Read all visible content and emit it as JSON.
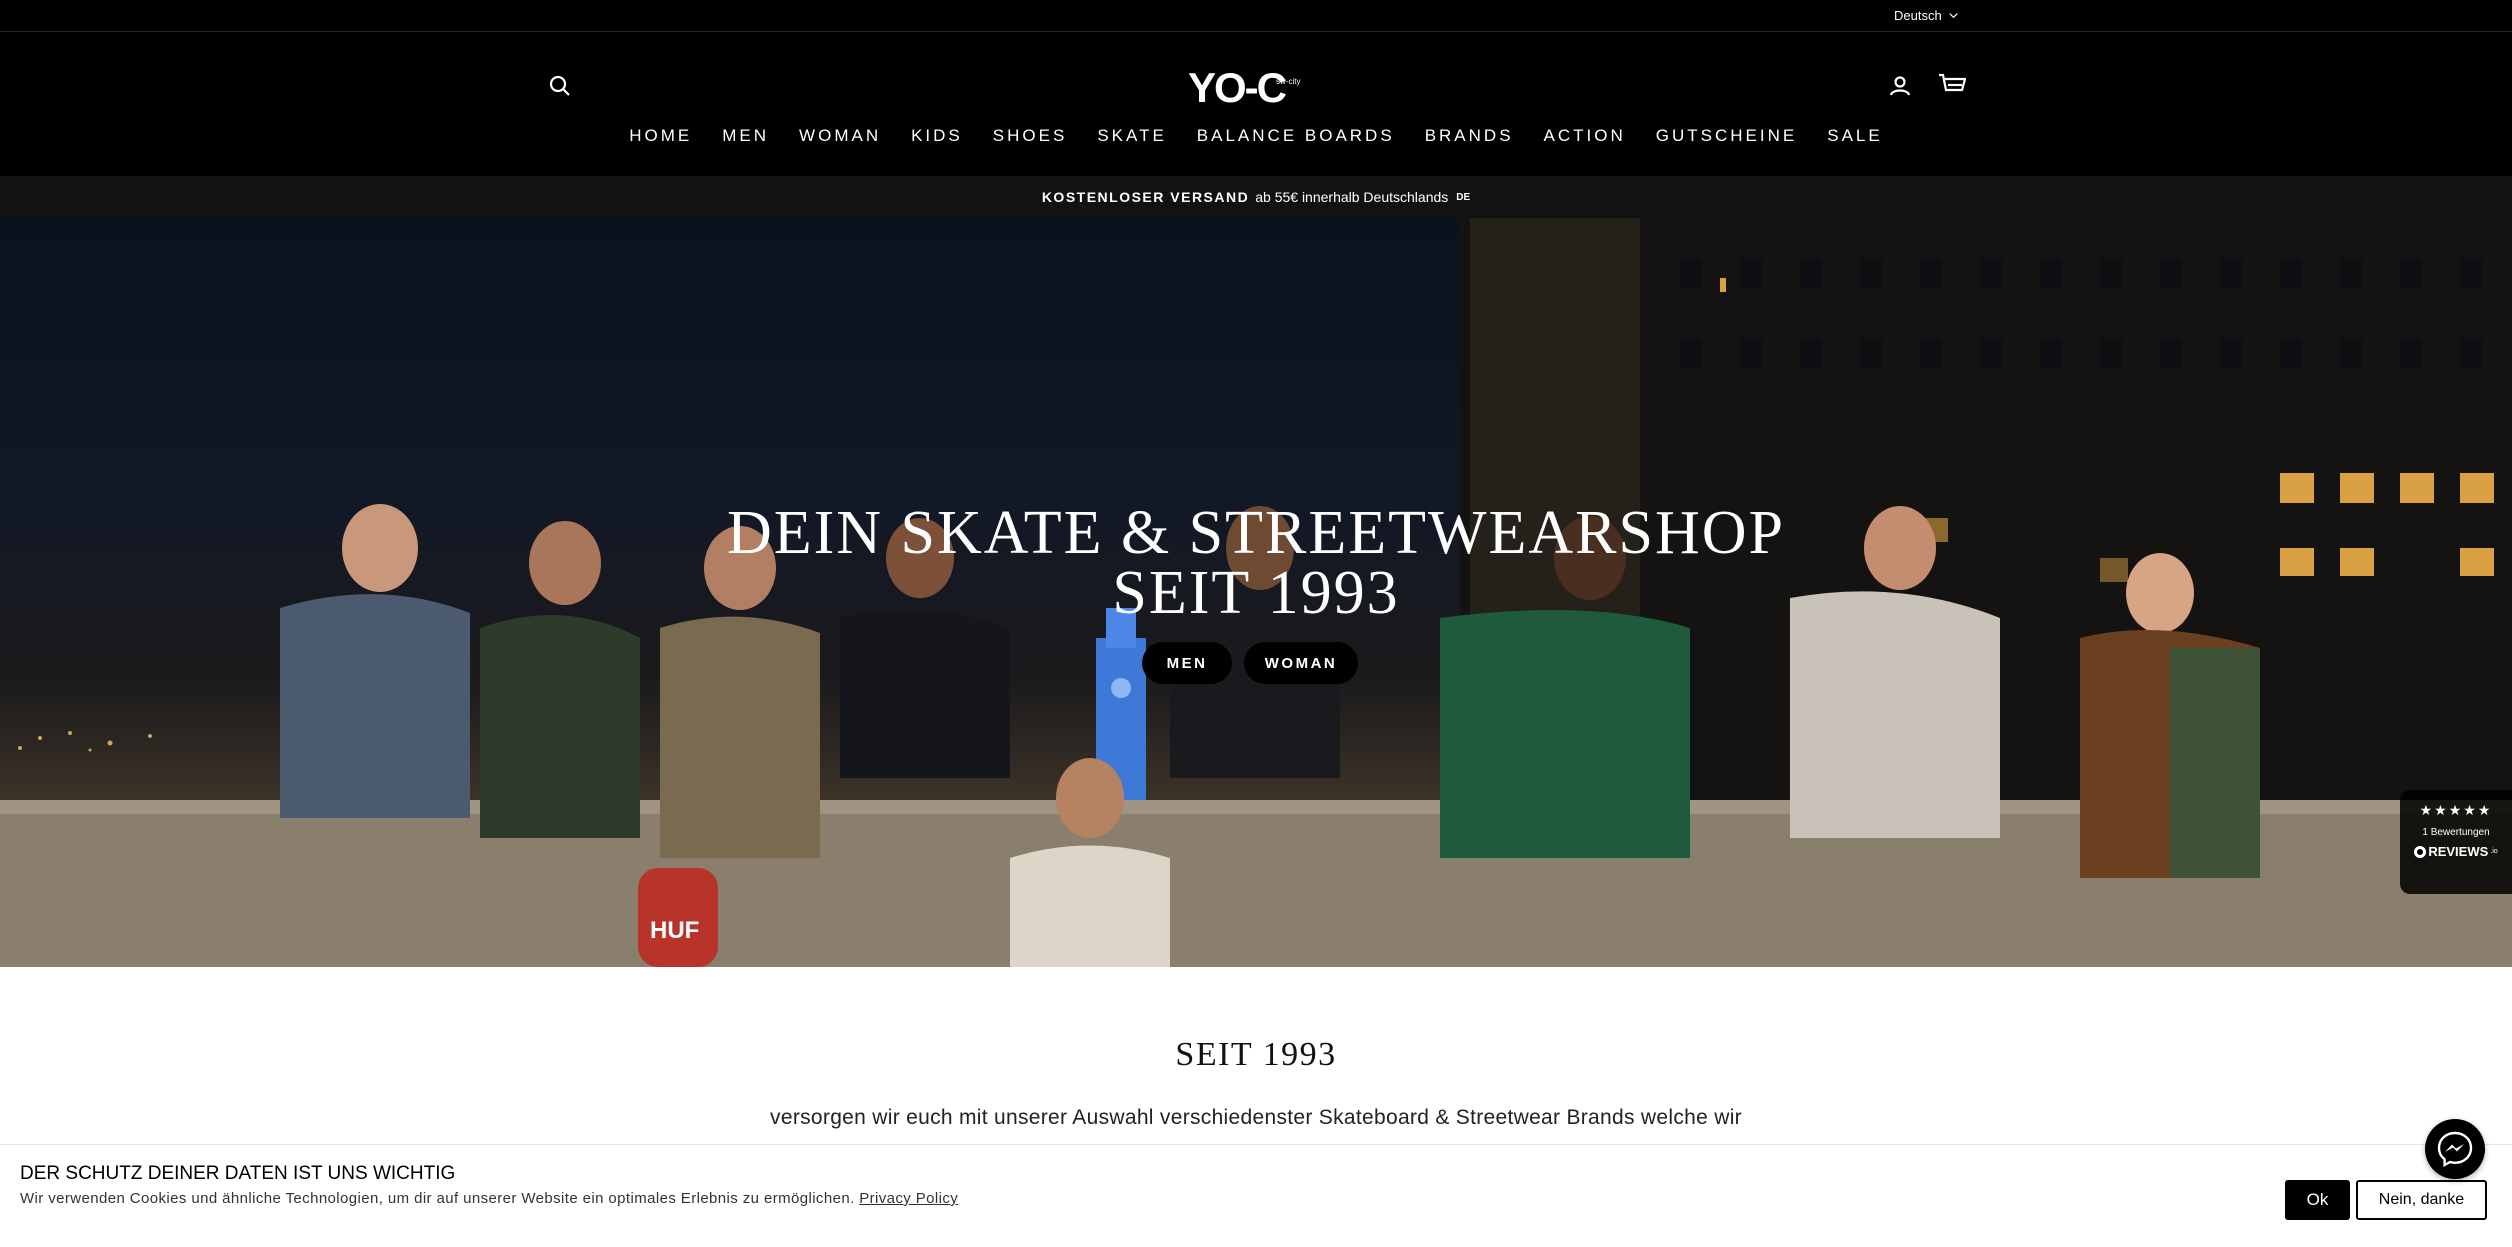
{
  "topbar": {
    "language": "Deutsch"
  },
  "header": {
    "logo_text": "YO-C",
    "logo_sub": "sw-city",
    "icons": {
      "search": "search-icon",
      "account": "account-icon",
      "cart": "cart-icon"
    }
  },
  "nav": {
    "items": [
      {
        "label": "HOME"
      },
      {
        "label": "MEN"
      },
      {
        "label": "WOMAN"
      },
      {
        "label": "KIDS"
      },
      {
        "label": "SHOES"
      },
      {
        "label": "SKATE"
      },
      {
        "label": "BALANCE BOARDS"
      },
      {
        "label": "BRANDS"
      },
      {
        "label": "ACTION"
      },
      {
        "label": "GUTSCHEINE"
      },
      {
        "label": "SALE"
      }
    ]
  },
  "promo": {
    "bold": "KOSTENLOSER VERSAND",
    "text": "ab 55€ innerhalb Deutschlands",
    "country": "DE"
  },
  "hero": {
    "title_line1": "DEIN SKATE & STREETWEARSHOP",
    "title_line2": "SEIT 1993",
    "button_men": "MEN",
    "button_woman": "WOMAN",
    "skateboard_text": "HUF"
  },
  "reviews": {
    "stars": "★★★★★",
    "count": "1 Bewertungen",
    "brand": "REVIEWS",
    "brand_suffix": ".io"
  },
  "section": {
    "title": "SEIT 1993",
    "text": "versorgen wir euch mit unserer Auswahl verschiedenster Skateboard & Streetwear Brands welche wir"
  },
  "cookie": {
    "title": "DER SCHUTZ DEINER DATEN IST UNS WICHTIG",
    "text": "Wir verwenden Cookies und ähnliche Technologien, um dir auf unserer Website ein optimales Erlebnis zu ermöglichen.",
    "link": "Privacy Policy",
    "ok": "Ok",
    "decline": "Nein, danke"
  },
  "colors": {
    "header_bg": "#000000",
    "promo_bg": "#121212",
    "accent": "#000000"
  }
}
